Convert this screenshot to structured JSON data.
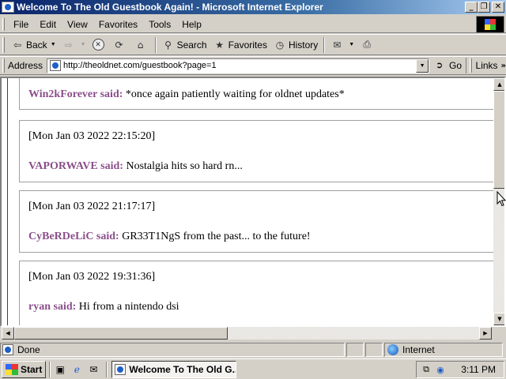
{
  "window": {
    "title": "Welcome To The Old Guestbook Again! - Microsoft Internet Explorer",
    "min_glyph": "_",
    "max_glyph": "❐",
    "close_glyph": "✕"
  },
  "menu": {
    "items": [
      {
        "label": "File"
      },
      {
        "label": "Edit"
      },
      {
        "label": "View"
      },
      {
        "label": "Favorites"
      },
      {
        "label": "Tools"
      },
      {
        "label": "Help"
      }
    ]
  },
  "toolbar": {
    "back_label": "Back",
    "search_label": "Search",
    "favorites_label": "Favorites",
    "history_label": "History",
    "icons": [
      "back-arrow-icon",
      "forward-arrow-icon",
      "stop-icon",
      "refresh-icon",
      "home-icon",
      "search-icon",
      "favorites-icon",
      "history-icon",
      "mail-icon",
      "print-icon"
    ]
  },
  "address_bar": {
    "label": "Address",
    "url": "http://theoldnet.com/guestbook?page=1",
    "go_label": "Go",
    "links_label": "Links"
  },
  "guestbook": {
    "entries": [
      {
        "timestamp": "",
        "name": "Win2kForever said:",
        "message": "*once again patiently waiting for oldnet updates*"
      },
      {
        "timestamp": "[Mon Jan 03 2022 22:15:20]",
        "name": "VAPORWAVE said:",
        "message": "Nostalgia hits so hard rn..."
      },
      {
        "timestamp": "[Mon Jan 03 2022 21:17:17]",
        "name": "CyBeRDeLiC said:",
        "message": "GR33T1NgS from the past... to the future!"
      },
      {
        "timestamp": "[Mon Jan 03 2022 19:31:36]",
        "name": "ryan said:",
        "message": "Hi from a nintendo dsi"
      }
    ]
  },
  "status_bar": {
    "text": "Done",
    "zone": "Internet"
  },
  "taskbar": {
    "start_label": "Start",
    "task_label": "Welcome To The Old G...",
    "clock": "3:11 PM"
  },
  "colors": {
    "titlebar_start": "#0a246a",
    "name_color": "#8a4f8a",
    "chrome": "#d4d0c8"
  }
}
